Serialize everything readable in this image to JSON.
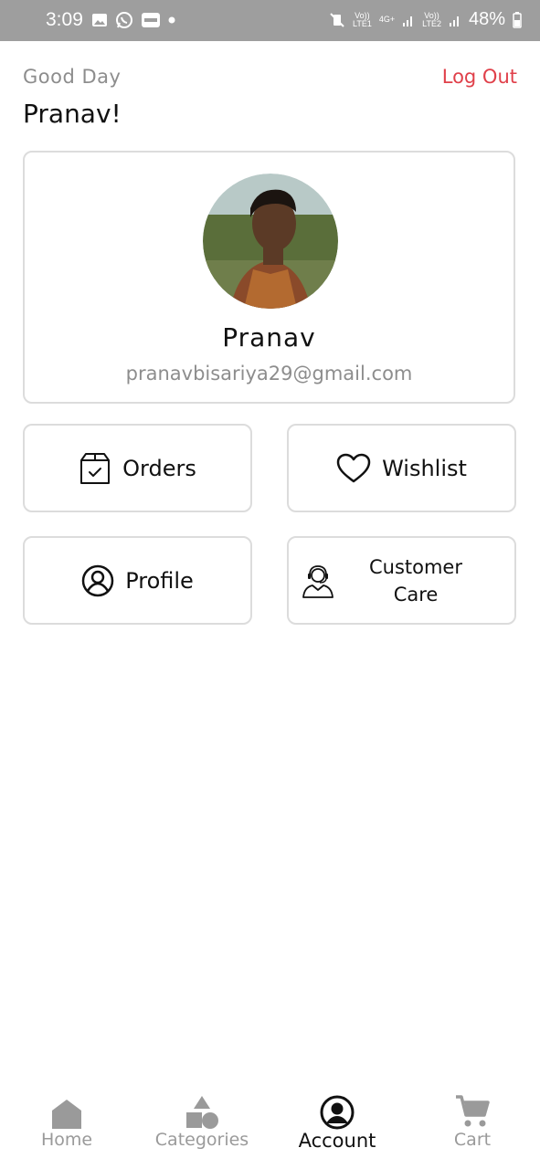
{
  "status_bar": {
    "time": "3:09",
    "left_icons": [
      "image-icon",
      "whatsapp-icon",
      "paytm-icon",
      "dot-icon"
    ],
    "right_icons": [
      "mute-vibrate-icon",
      "volte-lte1-icon",
      "4g-data-icon",
      "signal-icon",
      "volte-lte2-icon",
      "signal-icon",
      "battery-icon"
    ],
    "lte1_label": "Vo))\nLTE1",
    "net_label": "4G+",
    "lte2_label": "Vo))\nLTE2",
    "battery": "48%"
  },
  "header": {
    "greeting": "Good Day",
    "name": "Pranav!",
    "logout_label": "Log Out",
    "logout_color": "#e0404a"
  },
  "profile_card": {
    "name": "Pranav",
    "email": "pranavbisariya29@gmail.com"
  },
  "tiles": {
    "orders": {
      "label": "Orders",
      "icon": "box-check-icon"
    },
    "wishlist": {
      "label": "Wishlist",
      "icon": "heart-icon"
    },
    "profile": {
      "label": "Profile",
      "icon": "user-circle-icon"
    },
    "customer_care": {
      "label": "Customer Care",
      "icon": "headset-agent-icon"
    }
  },
  "bottom_nav": {
    "active": "Account",
    "items": [
      {
        "label": "Home",
        "icon": "home-icon"
      },
      {
        "label": "Categories",
        "icon": "shapes-icon"
      },
      {
        "label": "Account",
        "icon": "account-circle-icon"
      },
      {
        "label": "Cart",
        "icon": "cart-icon"
      }
    ]
  }
}
